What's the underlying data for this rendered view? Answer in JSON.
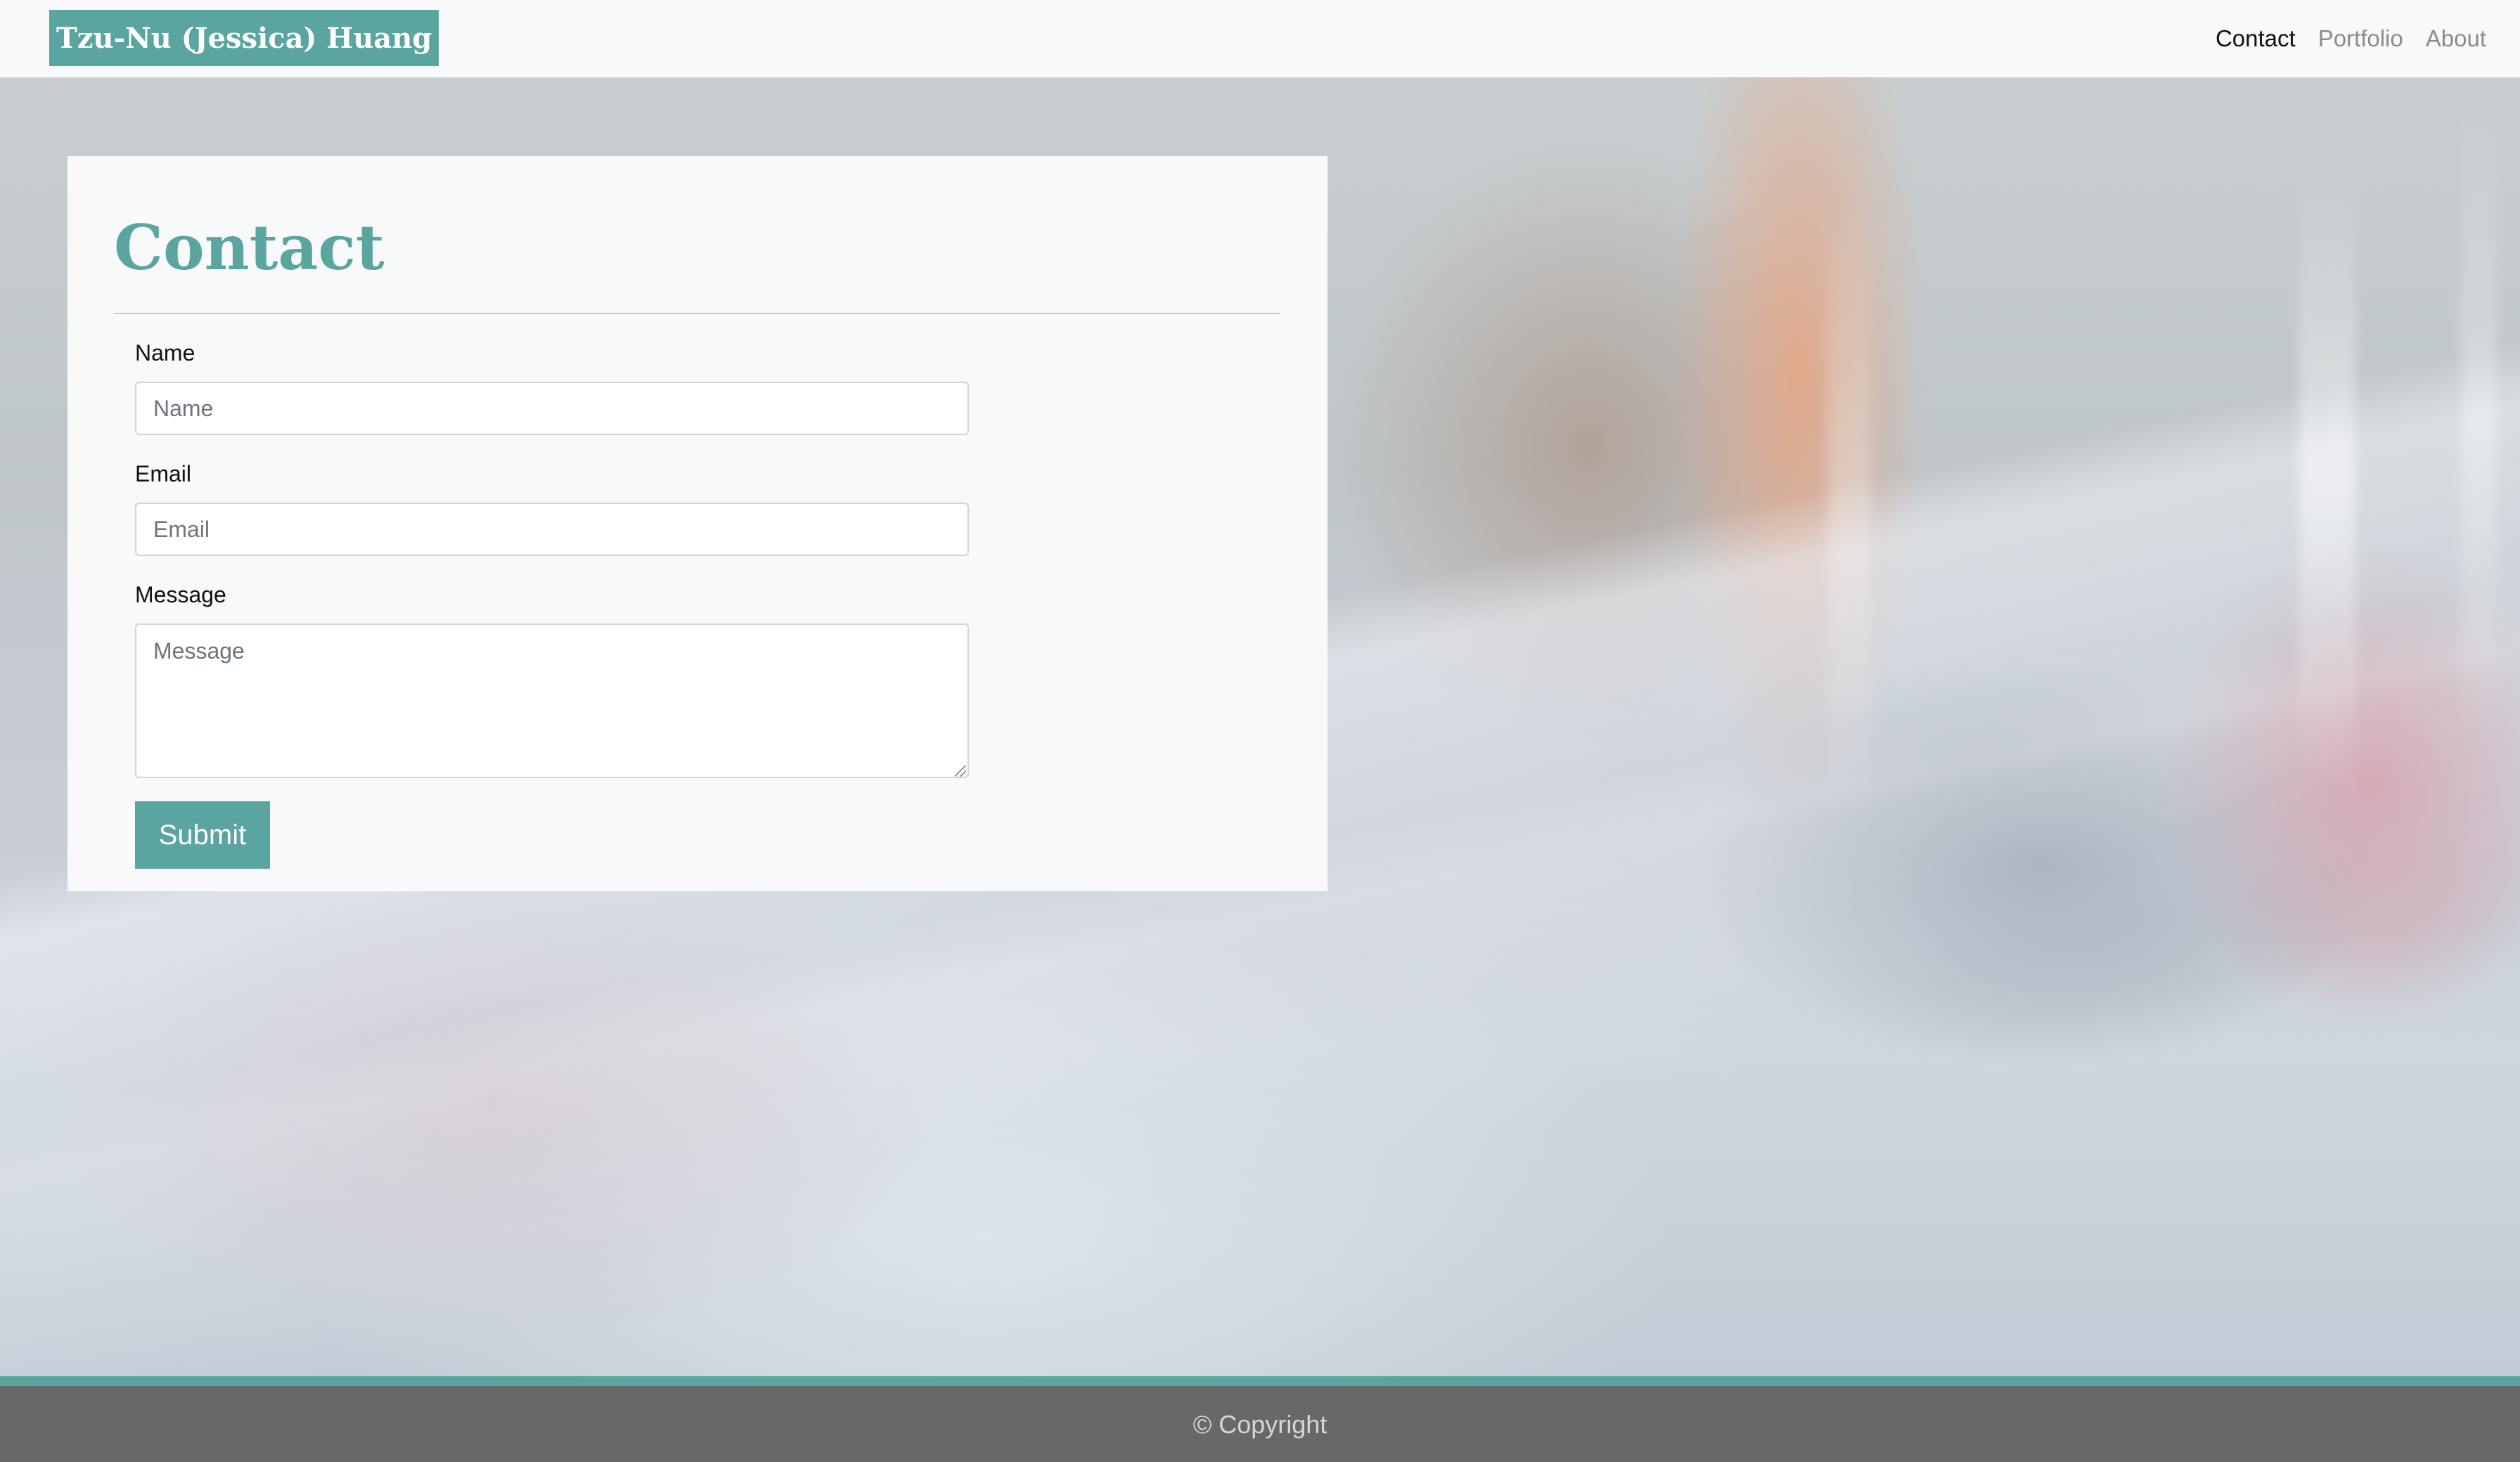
{
  "navbar": {
    "brand": "Tzu-Nu (Jessica) Huang",
    "links": [
      {
        "label": "Contact",
        "active": true
      },
      {
        "label": "Portfolio",
        "active": false
      },
      {
        "label": "About",
        "active": false
      }
    ]
  },
  "contact": {
    "title": "Contact",
    "fields": {
      "name": {
        "label": "Name",
        "placeholder": "Name",
        "value": ""
      },
      "email": {
        "label": "Email",
        "placeholder": "Email",
        "value": ""
      },
      "message": {
        "label": "Message",
        "placeholder": "Message",
        "value": ""
      }
    },
    "submit_label": "Submit"
  },
  "footer": {
    "text": "© Copyright"
  },
  "colors": {
    "accent": "#5aa5a0",
    "navbar_bg": "#f8f9fa",
    "footer_bg": "#686868"
  }
}
